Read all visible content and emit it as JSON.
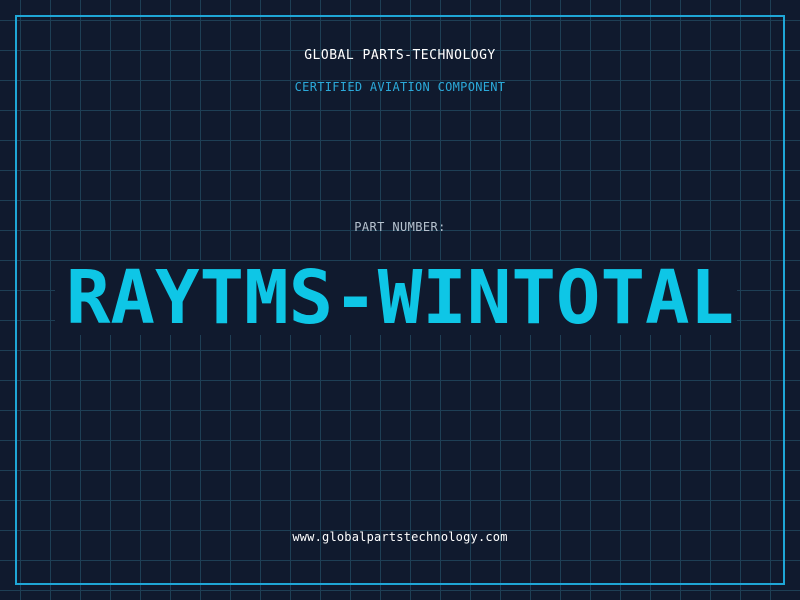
{
  "header": {
    "company_name": "GLOBAL PARTS-TECHNOLOGY",
    "tagline": "CERTIFIED AVIATION COMPONENT"
  },
  "part": {
    "label": "PART NUMBER:",
    "number": "RAYTMS-WINTOTAL"
  },
  "footer": {
    "website": "www.globalpartstechnology.com"
  },
  "colors": {
    "background": "#101a2e",
    "grid": "#1e3f55",
    "frame": "#1fa6d6",
    "accent": "#0ec6e6",
    "text": "#ffffff"
  }
}
